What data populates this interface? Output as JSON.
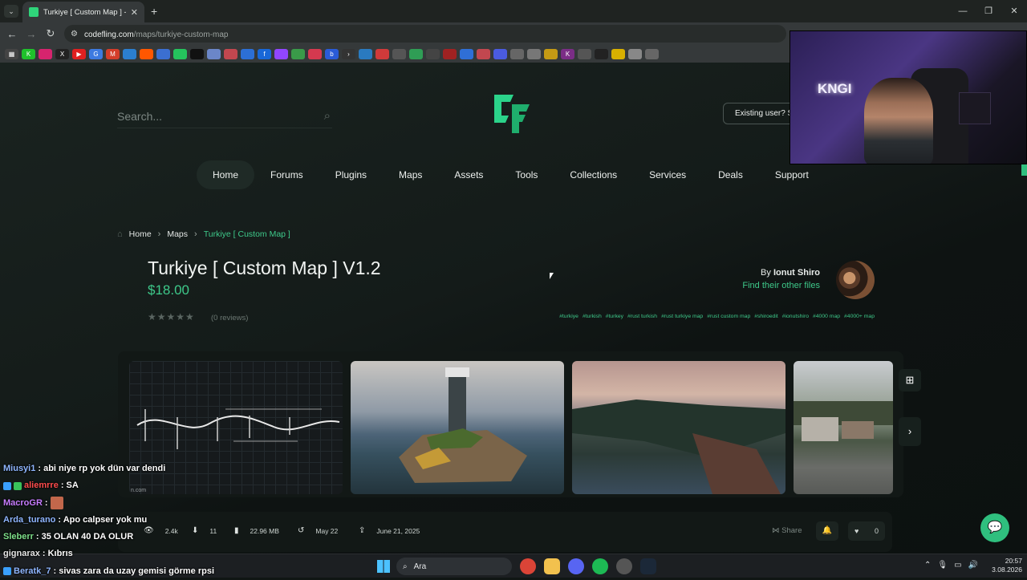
{
  "browser": {
    "tab_title": "Turkiye [ Custom Map ] - Maps",
    "url_host": "codefling.com",
    "url_path": "/maps/turkiye-custom-map"
  },
  "header": {
    "search_placeholder": "Search...",
    "login_label": "Existing user? Sign In"
  },
  "nav": [
    "Home",
    "Forums",
    "Plugins",
    "Maps",
    "Assets",
    "Tools",
    "Collections",
    "Services",
    "Deals",
    "Support"
  ],
  "breadcrumb": {
    "home": "Home",
    "maps": "Maps",
    "current": "Turkiye [ Custom Map ]"
  },
  "product": {
    "title": "Turkiye [ Custom Map ] V1.2",
    "price": "$18.00",
    "reviews": "(0 reviews)",
    "rating": 0,
    "by_prefix": "By",
    "author": "Ionut Shiro",
    "other_files": "Find their other files",
    "tags": [
      "#turkiye",
      "#turkish",
      "#turkey",
      "#rust turkish",
      "#rust turkiye map",
      "#rust custom map",
      "#shiroedit",
      "#ionutshiro",
      "#4000 map",
      "#4000+ map"
    ]
  },
  "gallery_caption": "n.com",
  "stats": {
    "views": "2.4k",
    "downloads": "11",
    "size": "22.96 MB",
    "updated": "May 22",
    "created": "June 21, 2025",
    "share": "Share",
    "likes": "0"
  },
  "chat": [
    {
      "user": "Miusyi1",
      "color": "#8fb6ff",
      "msg": ": abi niye rp yok dün var dendi",
      "badges": false,
      "emote": false
    },
    {
      "user": "aliemrre",
      "color": "#ff4d4d",
      "msg": ": SA",
      "badges": true,
      "emote": false
    },
    {
      "user": "MacroGR",
      "color": "#c77dff",
      "msg": ":",
      "badges": false,
      "emote": true
    },
    {
      "user": "Arda_turano",
      "color": "#8fb6ff",
      "msg": ": Apo calpser yok mu",
      "badges": false,
      "emote": false
    },
    {
      "user": "Sleberr",
      "color": "#7ee08a",
      "msg": ": 35 OLAN 40 DA OLUR",
      "badges": false,
      "emote": false
    },
    {
      "user": "gignarax",
      "color": "#e4e4e4",
      "msg": ": Kıbrıs",
      "badges": false,
      "emote": false
    },
    {
      "user": "Beratk_7",
      "color": "#8fb6ff",
      "msg": ": sivas zara da uzay gemisi görme rpsi ",
      "badges": true,
      "emote": false
    }
  ],
  "webcam": {
    "sign": "KNGI"
  },
  "taskbar": {
    "search": "Ara",
    "time": "20:57",
    "date": "3.08.2026"
  }
}
